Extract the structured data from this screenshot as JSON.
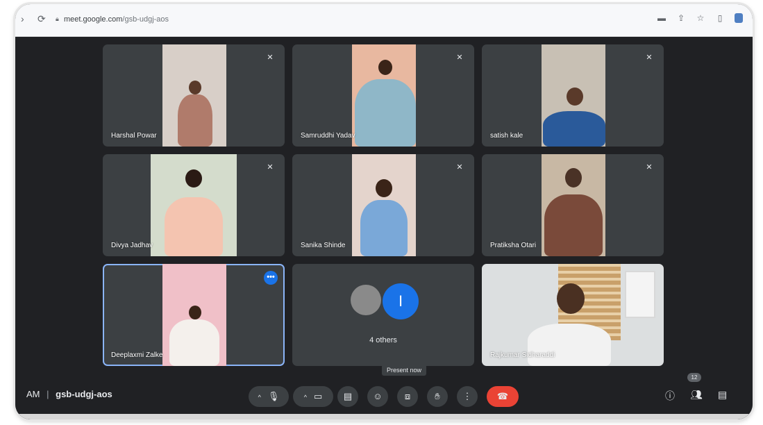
{
  "browser": {
    "url_host": "meet.google.com",
    "url_path": "/gsb-udgj-aos"
  },
  "participants": [
    {
      "name": "Harshal Powar"
    },
    {
      "name": "Samruddhi Yadav"
    },
    {
      "name": "satish kale"
    },
    {
      "name": "Divya Jadhav"
    },
    {
      "name": "Sanika Shinde"
    },
    {
      "name": "Pratiksha Otari"
    },
    {
      "name": "Deeplaxmi Zalke"
    },
    {
      "name": "Rajkumar Sidharaddi"
    }
  ],
  "others": {
    "label": "4 others",
    "avatar_letter": "I"
  },
  "meeting": {
    "time_fragment": "AM",
    "code": "gsb-udgj-aos"
  },
  "tooltip": "Present now",
  "people_count": "12",
  "colors": {
    "accent": "#1a73e8",
    "end_call": "#ea4335",
    "tile": "#3c4043",
    "background": "#202124"
  },
  "icons": [
    "back-icon",
    "reload-icon",
    "lock-icon",
    "camera-icon",
    "share-icon",
    "star-icon",
    "sidebar-icon",
    "mic-icon",
    "camera-off-icon",
    "captions-icon",
    "emoji-icon",
    "present-icon",
    "raise-hand-icon",
    "more-options-icon",
    "end-call-icon",
    "info-icon",
    "people-icon",
    "chat-icon",
    "mute-icon"
  ]
}
